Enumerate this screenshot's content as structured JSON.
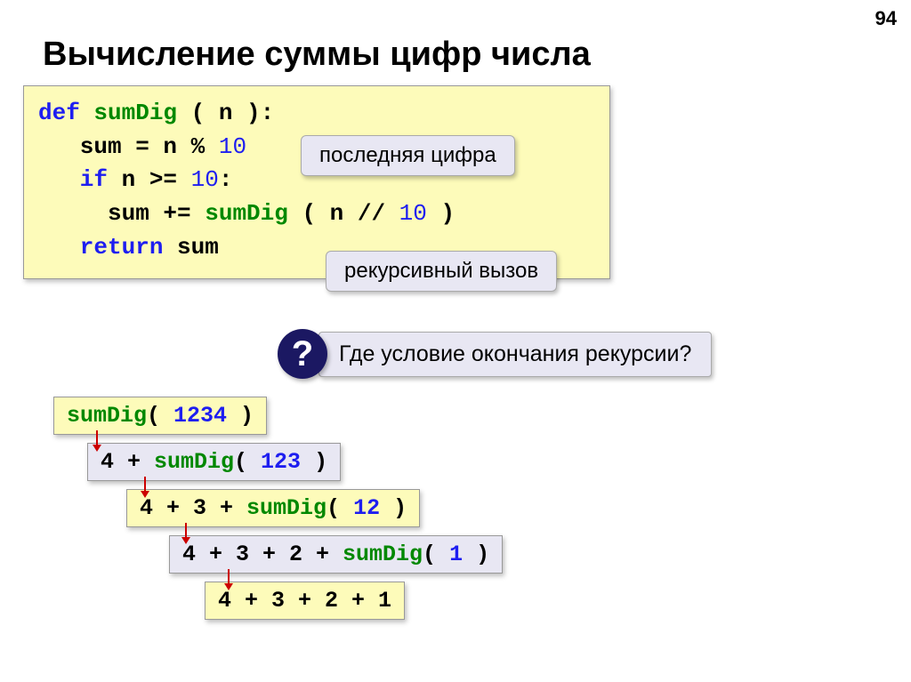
{
  "page_number": "94",
  "title": "Вычисление суммы цифр числа",
  "code": {
    "l1_def": "def ",
    "l1_fn": "sumDig ",
    "l1_rest": "( n ):",
    "l2_pre": "   sum = n % ",
    "l2_num": "10",
    "l3_if": "   if ",
    "l3_mid": "n >= ",
    "l3_num": "10",
    "l3_end": ":",
    "l4_pre": "     sum += ",
    "l4_fn": "sumDig ",
    "l4_mid": "( n // ",
    "l4_num": "10",
    "l4_end": " )",
    "l5_ret": "   return ",
    "l5_var": "sum"
  },
  "callouts": {
    "c1": "последняя цифра",
    "c2": "рекурсивный вызов"
  },
  "question": {
    "mark": "?",
    "text": "Где условие окончания рекурсии?"
  },
  "trace": {
    "t1_fn": "sumDig",
    "t1_open": "( ",
    "t1_arg": "1234",
    "t1_close": " )",
    "t2_pre": "4 + ",
    "t2_fn": "sumDig",
    "t2_open": "( ",
    "t2_arg": "123",
    "t2_close": " )",
    "t3_pre": "4 + 3 + ",
    "t3_fn": "sumDig",
    "t3_open": "( ",
    "t3_arg": "12",
    "t3_close": " )",
    "t4_pre": "4 + 3 + 2 + ",
    "t4_fn": "sumDig",
    "t4_open": "( ",
    "t4_arg": "1",
    "t4_close": " )",
    "t5": "4 + 3 + 2 + 1"
  }
}
